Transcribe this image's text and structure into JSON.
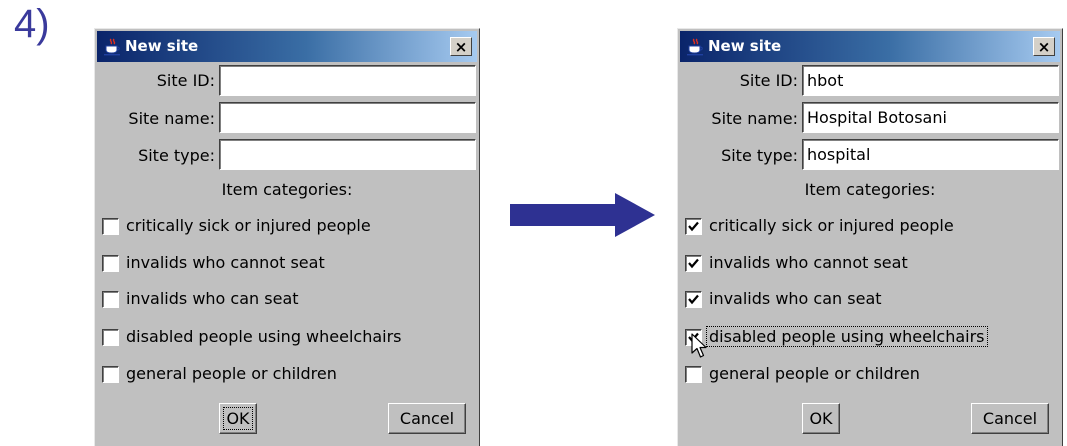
{
  "step_label": "4)",
  "dialogs": {
    "before": {
      "title": "New site",
      "close_glyph": "×",
      "fields": {
        "site_id": {
          "label": "Site ID:",
          "value": ""
        },
        "site_name": {
          "label": "Site name:",
          "value": ""
        },
        "site_type": {
          "label": "Site type:",
          "value": ""
        }
      },
      "categories_heading": "Item categories:",
      "categories": [
        {
          "label": "critically sick or injured people",
          "checked": false
        },
        {
          "label": "invalids who cannot seat",
          "checked": false
        },
        {
          "label": "invalids who can seat",
          "checked": false
        },
        {
          "label": "disabled people using wheelchairs",
          "checked": false
        },
        {
          "label": "general people or children",
          "checked": false
        }
      ],
      "ok_label": "OK",
      "cancel_label": "Cancel"
    },
    "after": {
      "title": "New site",
      "close_glyph": "×",
      "fields": {
        "site_id": {
          "label": "Site ID:",
          "value": "hbot"
        },
        "site_name": {
          "label": "Site name:",
          "value": "Hospital Botosani"
        },
        "site_type": {
          "label": "Site type:",
          "value": "hospital"
        }
      },
      "categories_heading": "Item categories:",
      "categories": [
        {
          "label": "critically sick or injured people",
          "checked": true
        },
        {
          "label": "invalids who cannot seat",
          "checked": true
        },
        {
          "label": "invalids who can seat",
          "checked": true
        },
        {
          "label": "disabled people using wheelchairs",
          "checked": true
        },
        {
          "label": "general people or children",
          "checked": false
        }
      ],
      "ok_label": "OK",
      "cancel_label": "Cancel"
    }
  },
  "icons": {
    "title_icon": "java-cup-icon",
    "transition": "right-arrow-icon",
    "pointer": "mouse-pointer-icon"
  },
  "colors": {
    "titlebar_start": "#0a246a",
    "titlebar_end": "#a6caf0",
    "dialog_bg": "#c0c0c0",
    "arrow": "#2e3192",
    "step_label": "#3a3a9c"
  }
}
